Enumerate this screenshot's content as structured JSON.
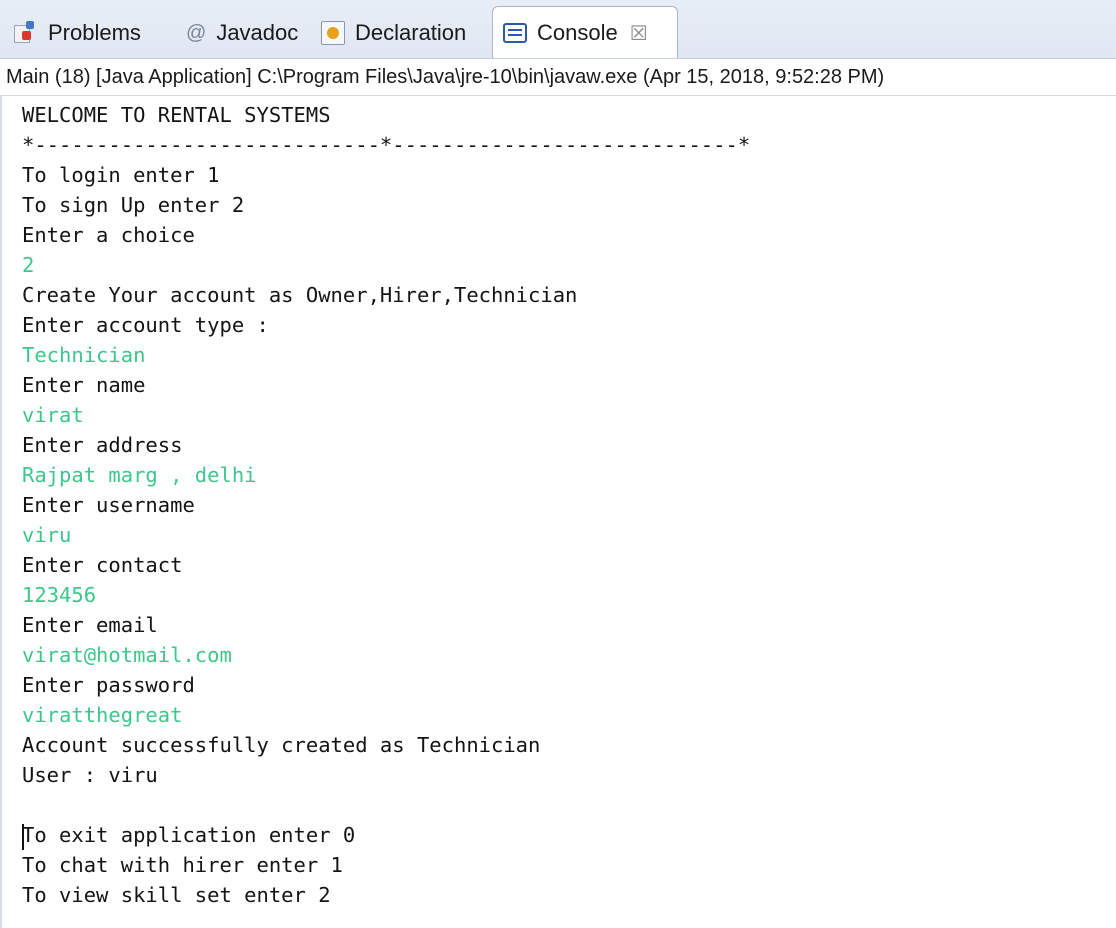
{
  "tabs": [
    {
      "label": "Problems",
      "icon": "problems-icon"
    },
    {
      "label": "Javadoc",
      "icon": "at-icon",
      "glyph": "@"
    },
    {
      "label": "Declaration",
      "icon": "declaration-icon"
    },
    {
      "label": "Console",
      "icon": "console-icon",
      "active": true,
      "close_glyph": "☒"
    }
  ],
  "console_header": "Main (18) [Java Application] C:\\Program Files\\Java\\jre-10\\bin\\javaw.exe (Apr 15, 2018, 9:52:28 PM)",
  "colors": {
    "input_text": "#3ec78a",
    "output_text": "#141414"
  },
  "lines": [
    {
      "text": "WELCOME TO RENTAL SYSTEMS",
      "type": "output"
    },
    {
      "text": "*----------------------------*----------------------------*",
      "type": "output"
    },
    {
      "text": "To login enter 1",
      "type": "output"
    },
    {
      "text": "To sign Up enter 2",
      "type": "output"
    },
    {
      "text": "Enter a choice",
      "type": "output"
    },
    {
      "text": "2",
      "type": "input"
    },
    {
      "text": "Create Your account as Owner,Hirer,Technician",
      "type": "output"
    },
    {
      "text": "Enter account type :",
      "type": "output"
    },
    {
      "text": "Technician",
      "type": "input"
    },
    {
      "text": "Enter name",
      "type": "output"
    },
    {
      "text": "virat",
      "type": "input"
    },
    {
      "text": "Enter address",
      "type": "output"
    },
    {
      "text": "Rajpat marg , delhi",
      "type": "input"
    },
    {
      "text": "Enter username",
      "type": "output"
    },
    {
      "text": "viru",
      "type": "input"
    },
    {
      "text": "Enter contact",
      "type": "output"
    },
    {
      "text": "123456",
      "type": "input"
    },
    {
      "text": "Enter email",
      "type": "output"
    },
    {
      "text": "virat@hotmail.com",
      "type": "input"
    },
    {
      "text": "Enter password",
      "type": "output"
    },
    {
      "text": "viratthegreat",
      "type": "input"
    },
    {
      "text": "Account successfully created as Technician",
      "type": "output"
    },
    {
      "text": "User : viru",
      "type": "output"
    },
    {
      "text": "",
      "type": "output"
    },
    {
      "text": "To exit application enter 0",
      "type": "output"
    },
    {
      "text": "To chat with hirer enter 1",
      "type": "output"
    },
    {
      "text": "To view skill set enter 2",
      "type": "output"
    }
  ]
}
